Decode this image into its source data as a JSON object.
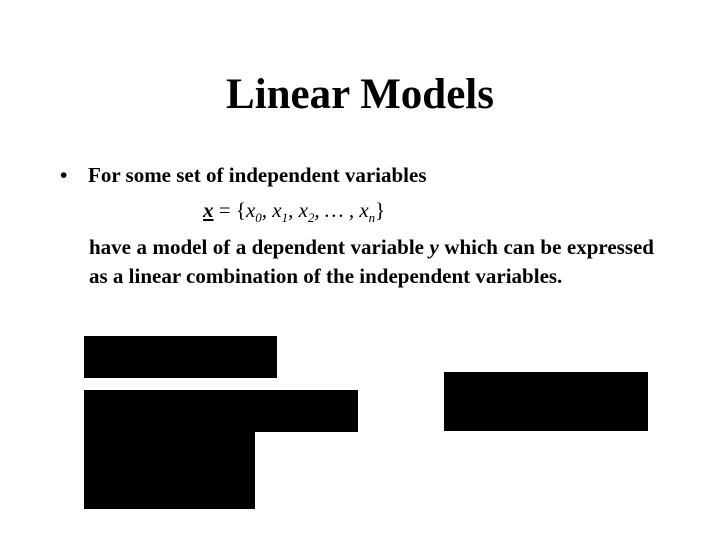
{
  "slide": {
    "title": "Linear Models",
    "bullet": {
      "marker": "•",
      "text": "For some set of independent variables"
    },
    "formula": {
      "lhs": "x",
      "equals": " = {",
      "terms": [
        "x",
        "0",
        ", x",
        "1",
        ", x",
        "2",
        ", … , x",
        "n"
      ],
      "close": "}"
    },
    "paragraph": {
      "before_y": " have a model of a dependent variable ",
      "y": "y",
      "after_y": " which can be expressed as a linear combination of the independent variables."
    },
    "redactions": {
      "color": "#000000",
      "count": 4
    }
  }
}
